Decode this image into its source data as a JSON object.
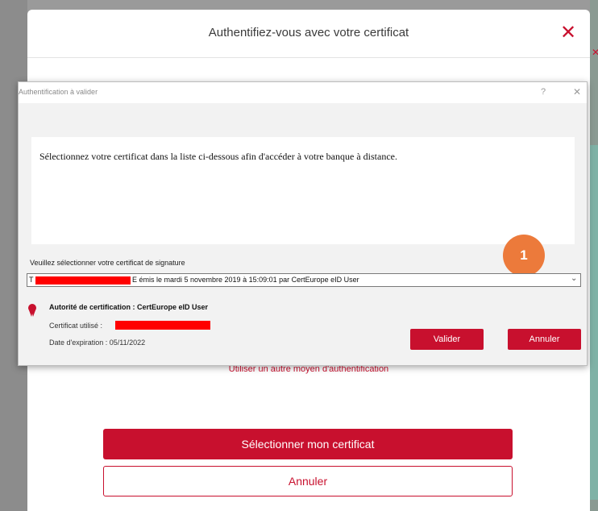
{
  "modal": {
    "title": "Authentifiez-vous avec votre certificat",
    "close_icon": "close-icon",
    "alt_auth_link": "Utiliser un autre moyen d'authentification",
    "primary_button": "Sélectionner mon certificat",
    "secondary_button": "Annuler"
  },
  "dialog": {
    "title": "Authentification à valider",
    "help_glyph": "?",
    "close_glyph": "✕",
    "message": "Sélectionnez votre certificat dans la liste ci-dessous afin d'accéder à votre banque à distance.",
    "step_badge": "1",
    "select_label": "Veuillez sélectionner votre certificat de signature",
    "select_prefix": "T",
    "select_value": "E émis le mardi 5 novembre 2019 à 15:09:01 par CertEurope eID User",
    "authority": "Autorité de certification : CertEurope eID User",
    "cert_used_label": "Certificat utilisé :",
    "expiry": "Date d'expiration : 05/11/2022",
    "validate_button": "Valider",
    "cancel_button": "Annuler"
  },
  "colors": {
    "brand_red": "#c8102e",
    "badge_orange": "#ec7a3b",
    "redaction": "#ff0000"
  }
}
